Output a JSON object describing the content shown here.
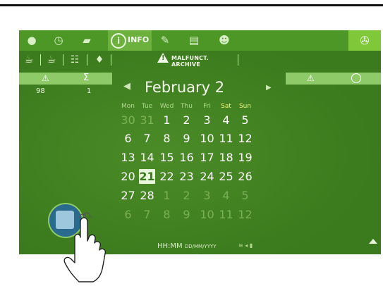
{
  "toolbar": {
    "info_label": "INFO",
    "icons": [
      "water-drop-icon",
      "clock-icon",
      "cup-icon",
      "info-icon",
      "brush-icon",
      "list-icon",
      "user-icon",
      "wrench-icon"
    ]
  },
  "submenu": {
    "archive_label": "MALFUNCT. ARCHIVE",
    "icons": [
      "coffee-cup-icon",
      "cup-sauce-icon",
      "sliders-icon",
      "drop-icon",
      "warning-icon"
    ]
  },
  "counts": {
    "headers": [
      "⚠",
      "Σ"
    ],
    "warnings": "98",
    "sum": "1"
  },
  "right_panel": {
    "headers": [
      "⚠",
      "clock"
    ]
  },
  "calendar": {
    "month_title": "February 2",
    "weekdays": [
      "Mon",
      "Tue",
      "Wed",
      "Thu",
      "Fri",
      "Sat",
      "Sun"
    ],
    "weeks": [
      [
        "30",
        "31",
        "1",
        "2",
        "3",
        "4",
        "5"
      ],
      [
        "6",
        "7",
        "8",
        "9",
        "10",
        "11",
        "12"
      ],
      [
        "13",
        "14",
        "15",
        "16",
        "17",
        "18",
        "19"
      ],
      [
        "20",
        "21",
        "22",
        "23",
        "24",
        "25",
        "26"
      ],
      [
        "27",
        "28",
        "1",
        "2",
        "3",
        "4",
        "5"
      ],
      [
        "6",
        "7",
        "8",
        "9",
        "10",
        "11",
        "12"
      ]
    ],
    "selected_day": "21"
  },
  "status_bar": {
    "time_label": "HH:MM",
    "date_label": "DD/MM/YYYY"
  },
  "colors": {
    "screen_bg": "#3b7a1d",
    "toolbar_bg": "#4c9726",
    "accent": "#7fc83a",
    "weekend": "#f3f27a"
  }
}
